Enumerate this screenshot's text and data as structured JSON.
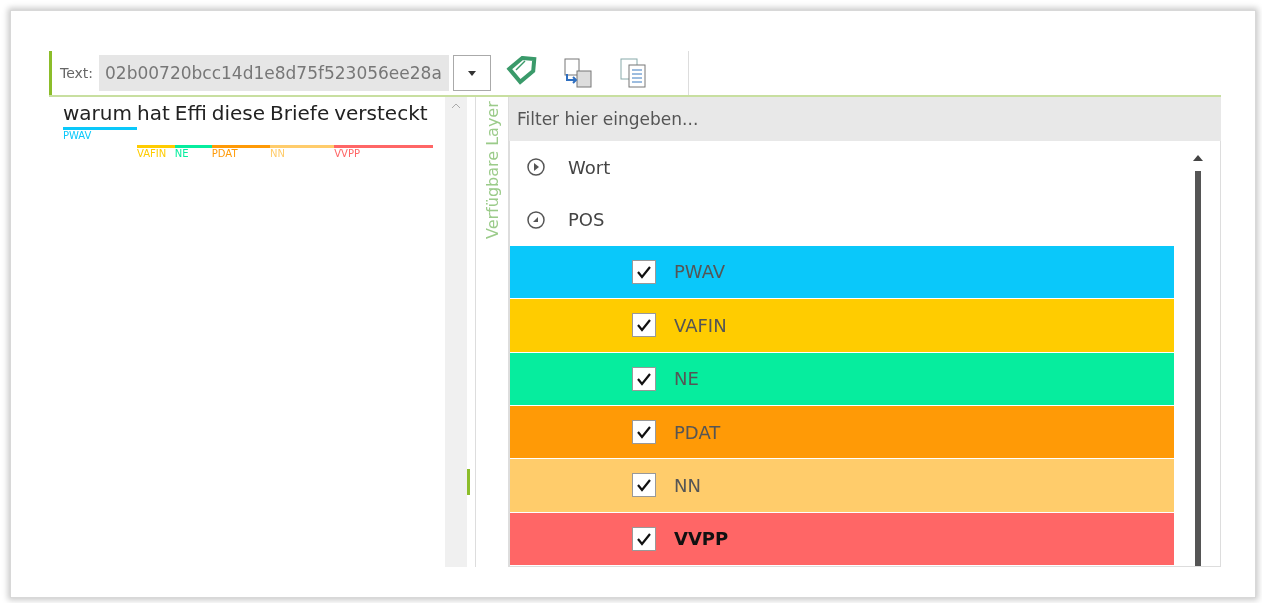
{
  "toolbar": {
    "label": "Text:",
    "value": "02b00720bcc14d1e8d75f523056ee28a"
  },
  "sentence": [
    {
      "word": "warum",
      "tag": "PWAV",
      "color": "#0ac8fa",
      "kind": "upper"
    },
    {
      "word": "hat",
      "tag": "VAFIN",
      "color": "#ffcc00",
      "kind": "lower"
    },
    {
      "word": "Effi",
      "tag": "NE",
      "color": "#06ed9e",
      "kind": "lower"
    },
    {
      "word": "diese",
      "tag": "PDAT",
      "color": "#ff9a06",
      "kind": "lower"
    },
    {
      "word": "Briefe",
      "tag": "NN",
      "color": "#ffcc6b",
      "kind": "lower"
    },
    {
      "word": "versteckt",
      "tag": "VVPP",
      "color": "#ff6666",
      "kind": "lower"
    }
  ],
  "side_tab": "Verfügbare Layer",
  "filter": {
    "placeholder": "Filter hier eingeben..."
  },
  "layers": [
    {
      "name": "Wort",
      "expanded": false
    },
    {
      "name": "POS",
      "expanded": true,
      "children": [
        {
          "name": "PWAV",
          "color": "#0ac8fa",
          "checked": true,
          "selected": false
        },
        {
          "name": "VAFIN",
          "color": "#ffcc00",
          "checked": true,
          "selected": false
        },
        {
          "name": "NE",
          "color": "#06ed9e",
          "checked": true,
          "selected": false
        },
        {
          "name": "PDAT",
          "color": "#ff9a06",
          "checked": true,
          "selected": false
        },
        {
          "name": "NN",
          "color": "#ffcc6b",
          "checked": true,
          "selected": false
        },
        {
          "name": "VVPP",
          "color": "#ff6666",
          "checked": true,
          "selected": true
        }
      ]
    }
  ]
}
